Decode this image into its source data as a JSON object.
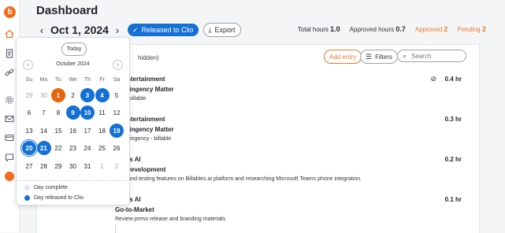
{
  "rail": {
    "logo": "b"
  },
  "header": {
    "title": "Dashboard",
    "date": "Oct 1, 2024",
    "released_label": "Released to Clio",
    "export_label": "Export",
    "total_hours_label": "Total hours",
    "total_hours_value": "1.0",
    "approved_hours_label": "Approved hours",
    "approved_hours_value": "0.7",
    "approved_label": "Approved",
    "approved_count": "2",
    "pending_label": "Pending",
    "pending_count": "2"
  },
  "toolbar": {
    "hidden_note": "hidden)",
    "add_entry": "Add entry",
    "filters": "Filters",
    "search_placeholder": "Search"
  },
  "entries": [
    {
      "client": "ar Entertainment",
      "matter": "Contingency Matter",
      "desc": "g nonbillable",
      "hours": "0.4 hr",
      "nonbillable": true
    },
    {
      "client": "ar Entertainment",
      "matter": "Contingency Matter",
      "desc": "g contingency - billable",
      "hours": "0.3 hr"
    },
    {
      "client": "lables AI",
      "matter": "uct Development",
      "desc": "wing and testing features on Billables.ai platform and researching Microsoft Teams phone integration.",
      "hours": "0.2 hr"
    },
    {
      "client": "lables AI",
      "matter": "Go-to-Market",
      "desc": "Review press release and branding materials",
      "hours": "0.1 hr"
    }
  ],
  "calendar": {
    "today_label": "Today",
    "month": "October 2024",
    "weekdays": [
      "Su",
      "Mo",
      "Tu",
      "We",
      "Th",
      "Fr",
      "Sa"
    ],
    "weeks": [
      [
        "29",
        "30",
        "1",
        "2",
        "3",
        "4",
        "5"
      ],
      [
        "6",
        "7",
        "8",
        "9",
        "10",
        "11",
        "12"
      ],
      [
        "13",
        "14",
        "15",
        "16",
        "17",
        "18",
        "19"
      ],
      [
        "20",
        "21",
        "22",
        "23",
        "24",
        "25",
        "26"
      ],
      [
        "27",
        "28",
        "29",
        "30",
        "31",
        "1",
        "2"
      ]
    ],
    "legend_complete": "Day complete",
    "legend_released": "Day released to Clio"
  },
  "colors": {
    "accent": "#f26b1d",
    "blue": "#1570d6",
    "pending": "#e7792a"
  }
}
